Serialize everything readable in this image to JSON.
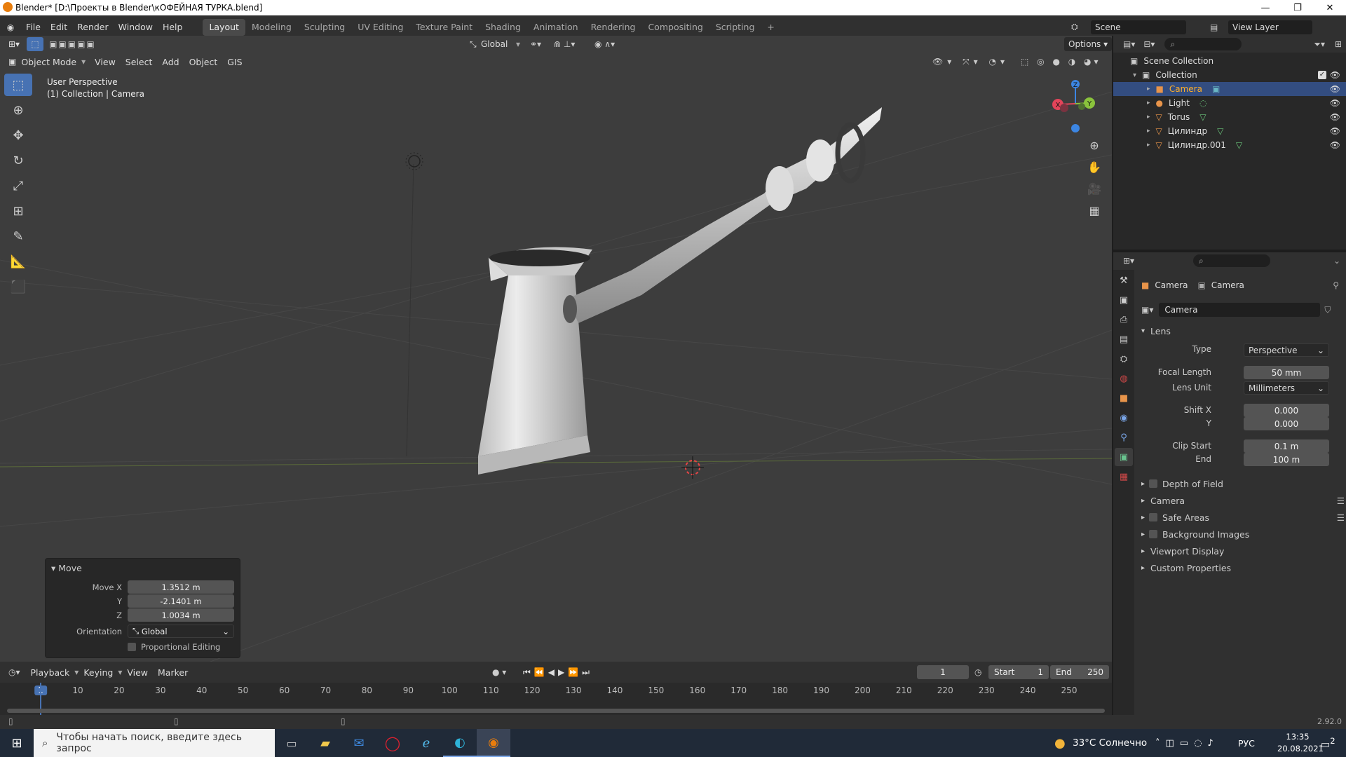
{
  "window": {
    "title": "Blender* [D:\\Проекты в Blender\\кОФЕЙНАЯ ТУРКА.blend]",
    "minimize": "—",
    "maximize": "❐",
    "close": "✕"
  },
  "menu": [
    "File",
    "Edit",
    "Render",
    "Window",
    "Help"
  ],
  "workspaces": [
    "Layout",
    "Modeling",
    "Sculpting",
    "UV Editing",
    "Texture Paint",
    "Shading",
    "Animation",
    "Rendering",
    "Compositing",
    "Scripting",
    "+"
  ],
  "scene": {
    "label": "Scene",
    "view_layer": "View Layer"
  },
  "viewport": {
    "orientation": "Global",
    "options_label": "Options",
    "mode": "Object Mode",
    "menus": [
      "View",
      "Select",
      "Add",
      "Object",
      "GIS"
    ],
    "overlay_line1": "User Perspective",
    "overlay_line2": "(1) Collection | Camera",
    "gizmo": {
      "x": "X",
      "y": "Y",
      "z": "Z"
    }
  },
  "move_panel": {
    "title": "Move",
    "rows": [
      {
        "label": "Move X",
        "value": "1.3512 m"
      },
      {
        "label": "Y",
        "value": "-2.1401 m"
      },
      {
        "label": "Z",
        "value": "1.0034 m"
      }
    ],
    "orientation_label": "Orientation",
    "orientation_value": "Global",
    "proportional": "Proportional Editing"
  },
  "timeline": {
    "menus": [
      "Playback",
      "Keying",
      "View",
      "Marker"
    ],
    "current_frame": "1",
    "start_label": "Start",
    "start": "1",
    "end_label": "End",
    "end": "250",
    "ticks": [
      "1",
      "10",
      "20",
      "30",
      "40",
      "50",
      "60",
      "70",
      "80",
      "90",
      "100",
      "110",
      "120",
      "130",
      "140",
      "150",
      "160",
      "170",
      "180",
      "190",
      "200",
      "210",
      "220",
      "230",
      "240",
      "250"
    ]
  },
  "status": {
    "version": "2.92.0"
  },
  "outliner": {
    "root": "Scene Collection",
    "collection": "Collection",
    "items": [
      {
        "name": "Camera",
        "selected": true
      },
      {
        "name": "Light",
        "selected": false
      },
      {
        "name": "Torus",
        "selected": false
      },
      {
        "name": "Цилиндр",
        "selected": false
      },
      {
        "name": "Цилиндр.001",
        "selected": false
      }
    ]
  },
  "properties": {
    "breadcrumb_object": "Camera",
    "breadcrumb_data": "Camera",
    "datablock": "Camera",
    "lens_section": "Lens",
    "fields": {
      "type_label": "Type",
      "type_value": "Perspective",
      "focal_label": "Focal Length",
      "focal_value": "50 mm",
      "unit_label": "Lens Unit",
      "unit_value": "Millimeters",
      "shiftx_label": "Shift X",
      "shiftx_value": "0.000",
      "shifty_label": "Y",
      "shifty_value": "0.000",
      "clipstart_label": "Clip Start",
      "clipstart_value": "0.1 m",
      "clipend_label": "End",
      "clipend_value": "100 m"
    },
    "sections": [
      "Depth of Field",
      "Camera",
      "Safe Areas",
      "Background Images",
      "Viewport Display",
      "Custom Properties"
    ]
  },
  "taskbar": {
    "search": "Чтобы начать поиск, введите здесь запрос",
    "weather": "33°C  Солнечно",
    "lang": "РУС",
    "time": "13:35",
    "date": "20.08.2021",
    "notifications": "2"
  },
  "colors": {
    "accent": "#4772b3",
    "selected_row": "#334d80",
    "viewport_bg": "#3d3d3d",
    "x_axis": "#e3445a",
    "y_axis": "#8ac33c",
    "z_axis": "#3c86e3"
  }
}
